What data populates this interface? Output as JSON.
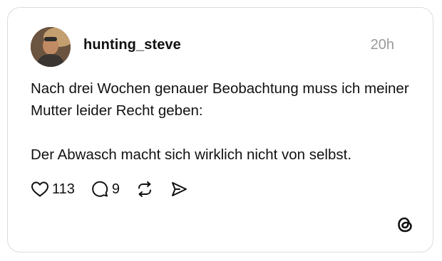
{
  "post": {
    "username": "hunting_steve",
    "time": "20h",
    "text": "Nach drei Wochen genauer Beobachtung muss ich meiner Mutter leider Recht geben:\n\nDer Abwasch macht sich wirklich nicht von selbst.",
    "likes": "113",
    "replies": "9"
  },
  "icons": {
    "like": "heart-icon",
    "reply": "comment-icon",
    "repost": "repost-icon",
    "share": "send-icon",
    "brand": "threads-logo-icon"
  }
}
